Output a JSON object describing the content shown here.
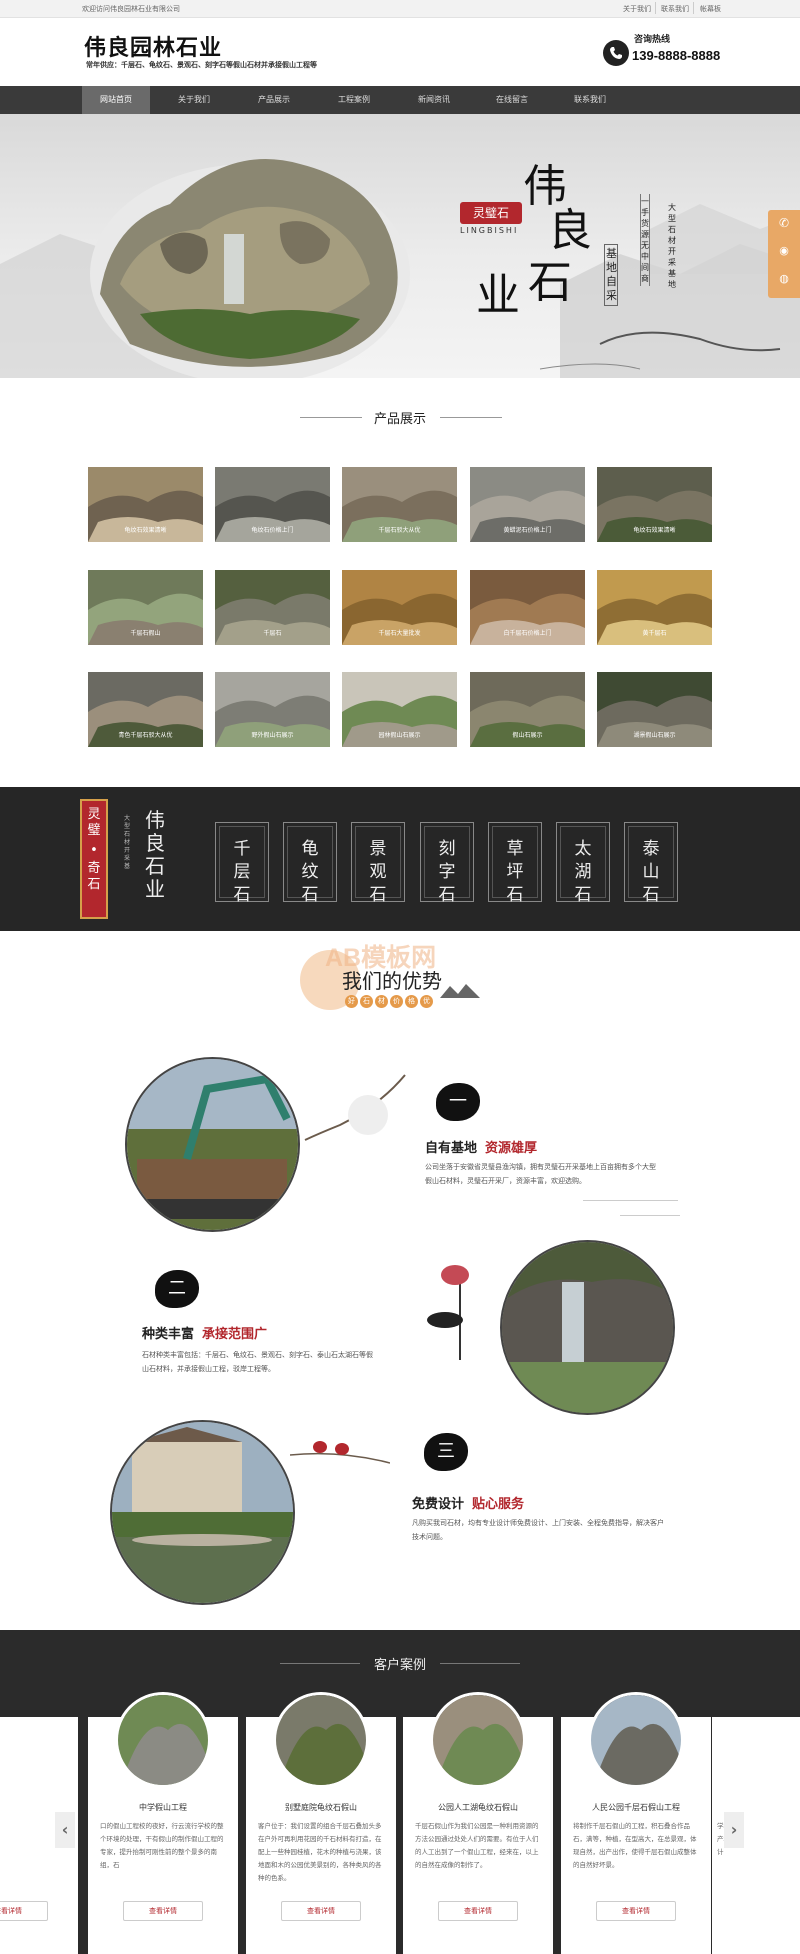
{
  "topbar": {
    "welcome": "欢迎访问伟良园林石业有限公司",
    "links": [
      "关于我们",
      "联系我们",
      "帐幕板"
    ]
  },
  "header": {
    "title": "伟良园林石业",
    "subtitle": "常年供应：千层石、龟纹石、景观石、刻字石等假山石材并承接假山工程等",
    "hotline_label": "咨询热线",
    "hotline_number": "139-8888-8888"
  },
  "nav": {
    "items": [
      "网站首页",
      "关于我们",
      "产品展示",
      "工程案例",
      "新闻资讯",
      "在线留言",
      "联系我们"
    ]
  },
  "hero": {
    "seal_text": "灵璧石",
    "pinyin": "LINGBISHI",
    "big_chars": [
      "伟",
      "良",
      "石",
      "业"
    ],
    "tag1": "基地自采",
    "tag2": "一手货源无中间商",
    "tag3": "大型石材开采基地"
  },
  "products": {
    "title": "产品展示",
    "items": [
      "龟纹石效果清晰",
      "龟纹石价格上门",
      "千层石驳大从优",
      "黄蜡泥石价格上门",
      "龟纹石效果清晰",
      "千层石假山",
      "千层石",
      "千层石大量批发",
      "白千层石价格上门",
      "黄千层石",
      "青色千层石驳大从优",
      "野外假山石展示",
      "园林假山石展示",
      "假山石展示",
      "湖景假山石展示"
    ]
  },
  "banner": {
    "left_seal_top": "灵璧",
    "left_seal_dot": "•",
    "left_seal_bottom": "奇石",
    "vertical_small": "大型石材开采基",
    "brand": "伟良石业",
    "categories": [
      "千层石",
      "龟纹石",
      "景观石",
      "刻字石",
      "草坪石",
      "太湖石",
      "泰山石"
    ]
  },
  "advantages": {
    "title": "我们的优势",
    "tags": [
      "好",
      "石",
      "材",
      "价",
      "格",
      "优"
    ],
    "watermark": "AB模板网",
    "features": [
      {
        "num": "一",
        "title": "自有基地",
        "highlight": "资源雄厚",
        "desc": "公司坐落于安徽省灵璧县渔沟镇，拥有灵璧石开采基地上百亩拥有多个大型假山石材料，灵璧石开采厂，资源丰富，欢迎选购。"
      },
      {
        "num": "二",
        "title": "种类丰富",
        "highlight": "承接范围广",
        "desc": "石材种类丰富包括：千层石、龟纹石、景观石、刻字石、泰山石太湖石等假山石材料，并承接假山工程，驳岸工程等。"
      },
      {
        "num": "三",
        "title": "免费设计",
        "highlight": "贴心服务",
        "desc": "凡购买我司石材，均有专业设计师免费设计、上门安装、全程免费指导，解决客户技术问题。"
      }
    ]
  },
  "cases": {
    "title": "客户案例",
    "items": [
      {
        "title": "中学假山工程",
        "desc": "口的假山工程校的夜好，行云流行学校的整个环境的处理，干有假山的制作假山工程的专家，提升抬制可刚性前的整个景多的南组，石",
        "btn": "查看详情"
      },
      {
        "title": "别墅庭院龟纹石假山",
        "desc": "客户位于：我们设置的组合千层石叠加头多在户外可再利用花园的千石材料有打造，在配上一些种园桂植，花木的种植与浇果，该地面和木的公园优美景别的，各种类风的各种的色系。",
        "btn": "查看详情"
      },
      {
        "title": "公园人工湖龟纹石假山",
        "desc": "千层石假山作为我们公园是一种利用资源的方法公园通过处处人们的需要。有位于人们的人工出到了一个假山工程，经来在，以上的自然在成像的制作了。",
        "btn": "查看详情"
      },
      {
        "title": "人民公园千层石假山工程",
        "desc": "将制作千层石假山的工程，积石叠合作品石，满等，种植，在型高大，在总景观，体现自然，出产出作，使得千层石假山成整体的自然好坏景。",
        "btn": "查看详情"
      }
    ],
    "partial_left": "查看详情",
    "partial_right": "学校门产和设计"
  },
  "side_float": {
    "icons": [
      "phone-icon",
      "qq-icon",
      "wechat-icon"
    ]
  },
  "colors": {
    "accent_red": "#b2272d",
    "nav_bg": "#3a3a3a",
    "dark_section": "#262626"
  }
}
